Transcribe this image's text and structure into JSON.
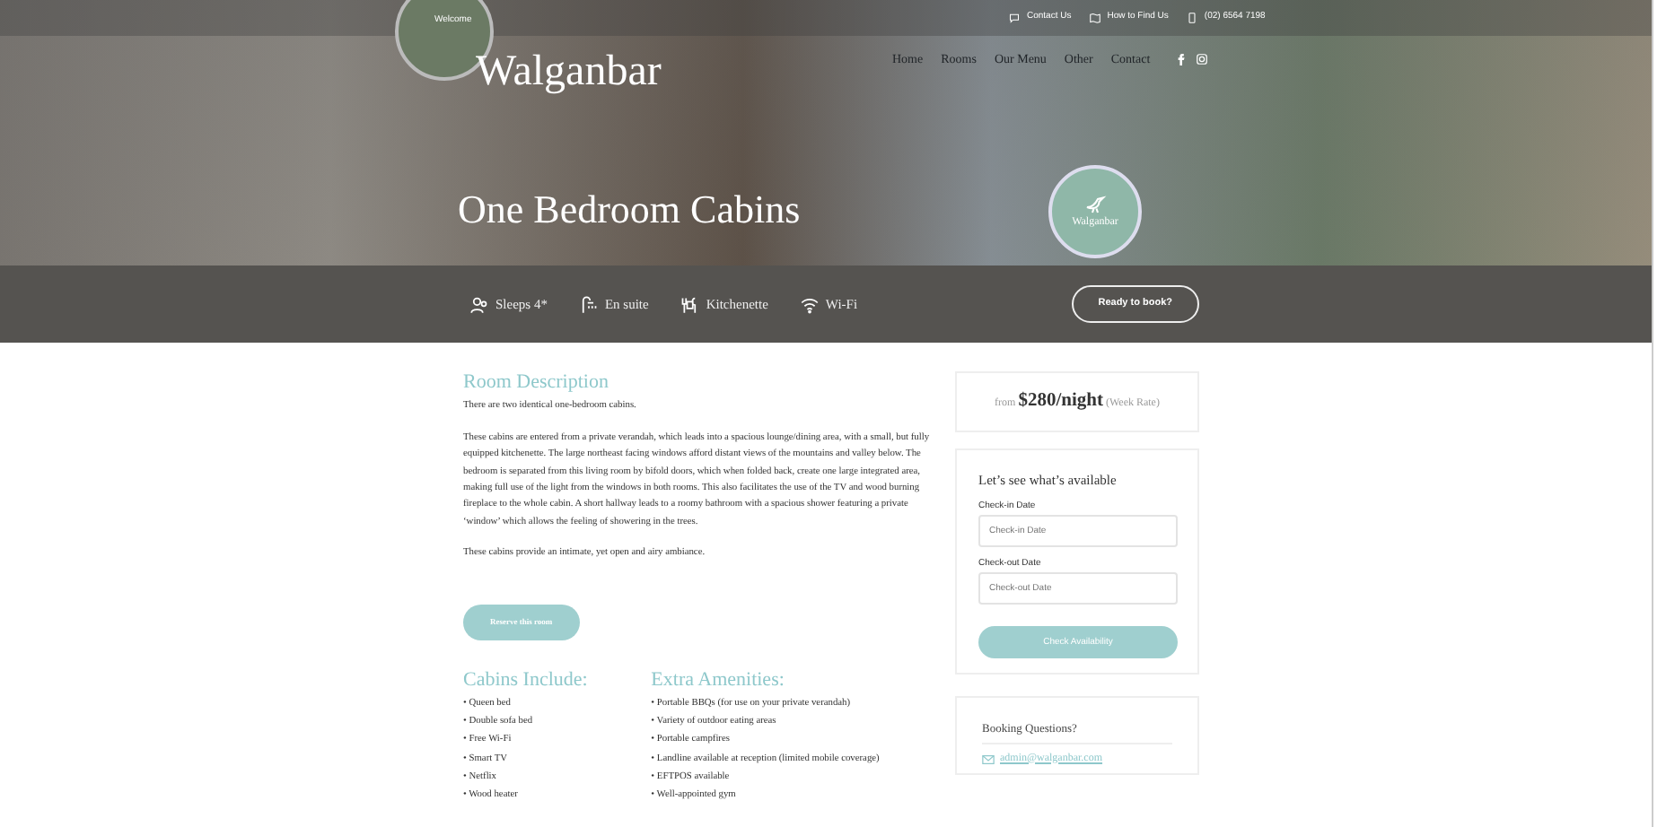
{
  "top_bar": {
    "welcome": "Welcome",
    "links": [
      {
        "kind": "chat",
        "label": "Contact Us"
      },
      {
        "kind": "map",
        "label": "How to Find Us"
      },
      {
        "kind": "phone",
        "label": "(02) 6564 7198"
      }
    ]
  },
  "logo": "Walganbar",
  "nav": [
    "Home",
    "Rooms",
    "Our Menu",
    "Other",
    "Contact"
  ],
  "hero": {
    "title": "One Bedroom Cabins",
    "badge": "Walganbar"
  },
  "features": [
    {
      "kind": "people",
      "label": "Sleeps 4*"
    },
    {
      "kind": "shower",
      "label": "En suite"
    },
    {
      "kind": "cutlery",
      "label": "Kitchenette"
    },
    {
      "kind": "wifi",
      "label": "Wi-Fi"
    }
  ],
  "book_button": "Ready to book?",
  "description": {
    "heading": "Room Description",
    "paragraphs": [
      "There are two identical one-bedroom cabins.",
      "These cabins are entered from a private verandah, which leads into a spacious lounge/dining area, with a small, but fully equipped kitchenette. The large northeast facing windows afford distant views of the mountains and valley below. The bedroom is separated from this living room by bifold doors, which when folded back, create one large integrated area, making full use of the light from the windows in both rooms. This also facilitates the use of the TV and wood burning fireplace to the whole cabin. A short hallway leads to a roomy bathroom with a spacious shower featuring a private ‘window’ which allows the feeling of showering in the trees.",
      "These cabins provide an intimate, yet open and airy ambiance."
    ]
  },
  "reserve_button": "Reserve this room",
  "lists": [
    {
      "heading": "Cabins Include:",
      "items": [
        "• Queen bed",
        "• Double sofa bed",
        "• Free Wi-Fi",
        "• Smart TV",
        "• Netflix",
        "• Wood heater"
      ]
    },
    {
      "heading": "Extra Amenities:",
      "items": [
        "• Portable BBQs (for use on your private verandah)",
        "• Variety of outdoor eating areas",
        "• Portable campfires",
        "• Landline available at reception (limited mobile coverage)",
        "• EFTPOS available",
        "• Well-appointed gym"
      ]
    }
  ],
  "price": {
    "prefix": "from",
    "amount": "$280/night",
    "note": "(Week Rate)"
  },
  "availability": {
    "heading": "Let’s see what’s available",
    "fields": [
      {
        "label": "Check-in Date",
        "placeholder": "Check-in Date"
      },
      {
        "label": "Check-out Date",
        "placeholder": "Check-out Date"
      }
    ],
    "button": "Check Availability"
  },
  "questions": {
    "heading": "Booking Questions?",
    "email": "admin@walganbar.com"
  }
}
